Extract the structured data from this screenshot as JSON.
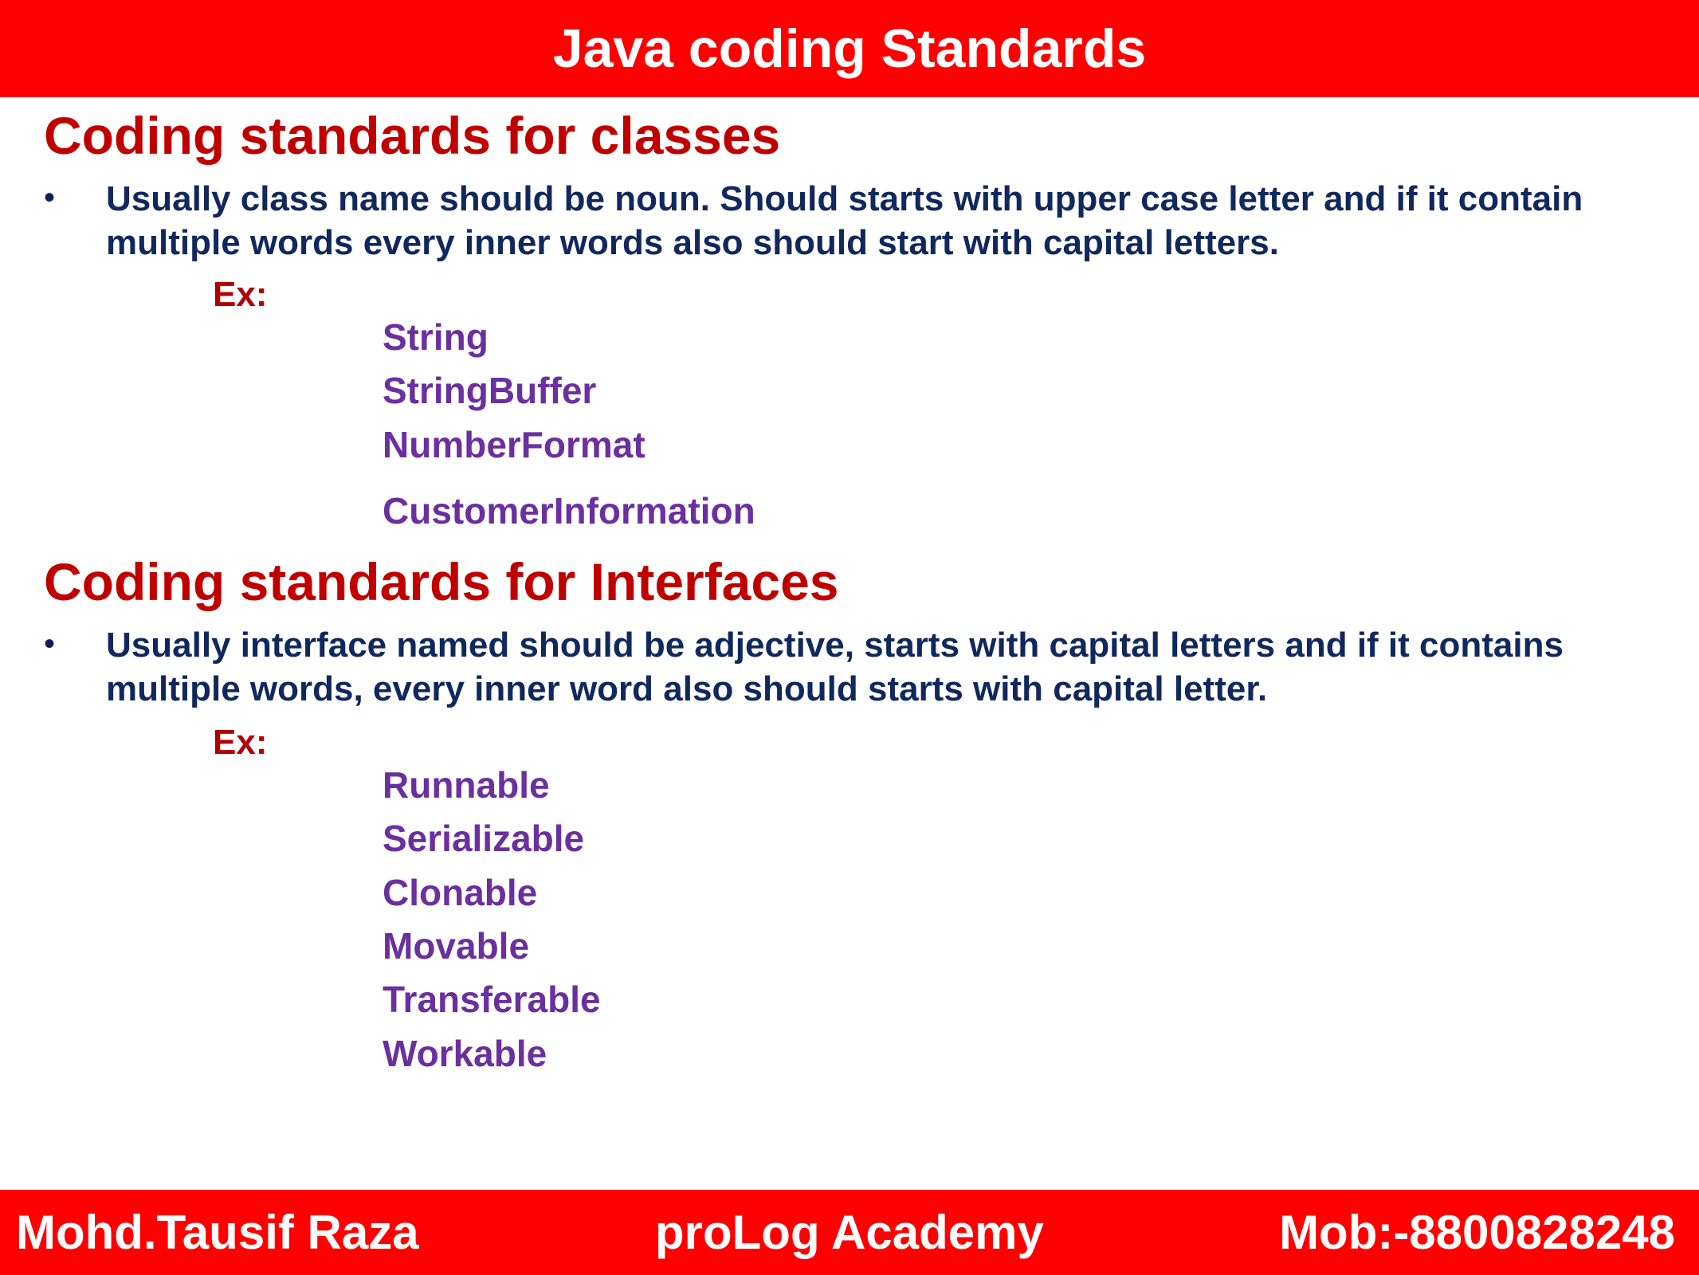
{
  "header": {
    "title": "Java coding Standards"
  },
  "sections": [
    {
      "heading": "Coding standards for classes",
      "bullet_symbol": "•",
      "bullet_text": "Usually class name should be noun. Should starts with upper case letter and if it contain multiple words every inner words also should start with capital letters.",
      "ex_label": "Ex:",
      "examples": [
        "String",
        "StringBuffer",
        "NumberFormat",
        "CustomerInformation"
      ]
    },
    {
      "heading": "Coding standards for Interfaces",
      "bullet_symbol": "•",
      "bullet_text": "Usually interface named should be adjective, starts with capital letters and if it contains multiple words, every inner word also should starts with capital letter.",
      "ex_label": "Ex:",
      "examples": [
        "Runnable",
        "Serializable",
        "Clonable",
        "Movable",
        "Transferable",
        "Workable"
      ]
    }
  ],
  "footer": {
    "author": "Mohd.Tausif Raza",
    "academy": "proLog Academy",
    "mobile": "Mob:-8800828248"
  },
  "colors": {
    "banner": "#ff0000",
    "heading": "#c00000",
    "body_text": "#10285e",
    "example_text": "#6b2fa0"
  }
}
